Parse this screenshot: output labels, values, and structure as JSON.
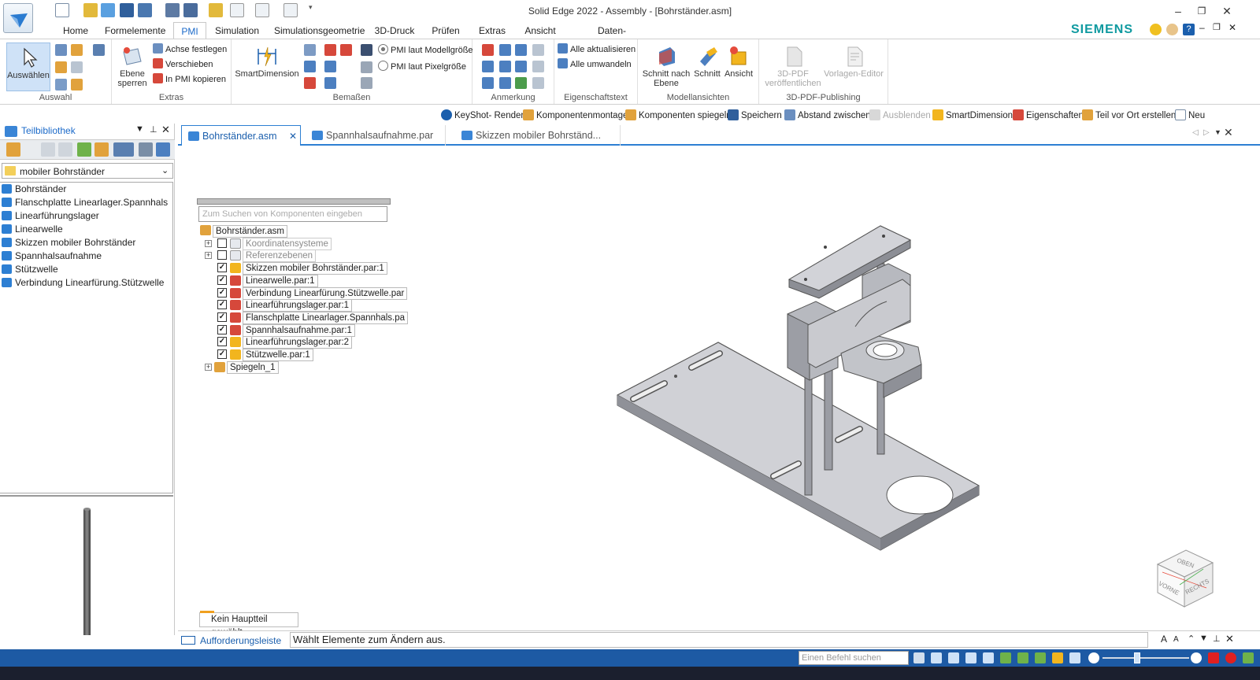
{
  "window": {
    "title": "Solid Edge 2022 - Assembly - [Bohrständer.asm]",
    "minimize": "–",
    "restore": "❐",
    "close": "✕",
    "brand": "SIEMENS"
  },
  "ribbon_tabs": [
    "Home",
    "Formelemente",
    "PMI",
    "Simulation",
    "Simulationsgeometrie",
    "3D-Druck",
    "Prüfen",
    "Extras",
    "Ansicht",
    "Daten-Management"
  ],
  "ribbon_active_tab": "PMI",
  "ribbon": {
    "auswahl": {
      "label": "Auswahl",
      "select_button": "Auswählen"
    },
    "extras": {
      "label": "Extras",
      "ebene_sperren": "Ebene sperren",
      "achse_festlegen": "Achse festlegen",
      "verschieben": "Verschieben",
      "in_pmi_kopieren": "In PMI kopieren"
    },
    "bemassen": {
      "label": "Bemaßen",
      "smartdimension": "SmartDimension",
      "pmi_modell": "PMI laut Modellgröße",
      "pmi_pixel": "PMI laut Pixelgröße"
    },
    "anmerkung": {
      "label": "Anmerkung"
    },
    "eigenschaftstext": {
      "label": "Eigenschaftstext",
      "alle_aktualisieren": "Alle aktualisieren",
      "alle_umwandeln": "Alle umwandeln"
    },
    "modellansichten": {
      "label": "Modellansichten",
      "schnitt_nach_ebene": "Schnitt nach Ebene",
      "schnitt": "Schnitt",
      "ansicht": "Ansicht"
    },
    "publishing": {
      "label": "3D-PDF-Publishing",
      "pdf_veroeffentlichen": "3D-PDF veröffentlichen",
      "vorlagen_editor": "Vorlagen-Editor"
    }
  },
  "command_bar": [
    "KeyShot- Render",
    "Komponentenmontage",
    "Komponenten spiegeln",
    "Speichern",
    "Abstand zwischen",
    "Ausblenden",
    "SmartDimension",
    "Eigenschaften",
    "Teil vor Ort erstellen",
    "Neu"
  ],
  "library": {
    "title": "Teilbibliothek",
    "folder": "mobiler Bohrständer",
    "items": [
      "Bohrständer",
      "Flanschplatte Linearlager.Spannhals",
      "Linearführungslager",
      "Linearwelle",
      "Skizzen mobiler Bohrständer",
      "Spannhalsaufnahme",
      "Stützwelle",
      "Verbindung Linearfürung.Stützwelle"
    ]
  },
  "doc_tabs": [
    "Bohrständer.asm",
    "Spannhalsaufnahme.par",
    "Skizzen mobiler Bohrständ..."
  ],
  "pathfinder": {
    "search_placeholder": "Zum Suchen von Komponenten eingeben",
    "root": "Bohrständer.asm",
    "rows": [
      {
        "label": "Koordinatensysteme",
        "checked": false,
        "expandable": true,
        "dim": true
      },
      {
        "label": "Referenzebenen",
        "checked": false,
        "expandable": true,
        "dim": true
      },
      {
        "label": "Skizzen mobiler Bohrständer.par:1",
        "checked": true
      },
      {
        "label": "Linearwelle.par:1",
        "checked": true
      },
      {
        "label": "Verbindung Linearfürung.Stützwelle.par",
        "checked": true
      },
      {
        "label": "Linearführungslager.par:1",
        "checked": true
      },
      {
        "label": "Flanschplatte Linearlager.Spannhals.pa",
        "checked": true
      },
      {
        "label": "Spannhalsaufnahme.par:1",
        "checked": true
      },
      {
        "label": "Linearführungslager.par:2",
        "checked": true
      },
      {
        "label": "Stützwelle.par:1",
        "checked": true
      }
    ],
    "mirror": "Spiegeln_1"
  },
  "no_main_part": "Kein Hauptteil gewählt.",
  "view_cube": {
    "top": "OBEN",
    "front": "VORNE",
    "right": "RECHTS"
  },
  "prompt": {
    "label": "Aufforderungsleiste",
    "text": "Wählt Elemente zum Ändern aus."
  },
  "status": {
    "command_search_placeholder": "Einen Befehl suchen"
  }
}
